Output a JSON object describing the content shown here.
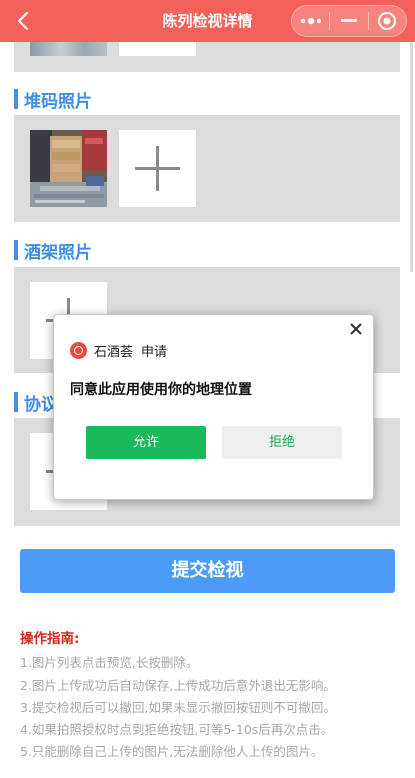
{
  "header": {
    "title": "陈列检视详情",
    "bg_color": "#f4605a",
    "back_icon": "chevron-left-icon",
    "menu_icon": "more-dots-icon",
    "minimize_icon": "minimize-icon",
    "close_icon": "target-close-icon"
  },
  "sections": [
    {
      "title": "堆码照片",
      "has_photo": true
    },
    {
      "title": "酒架照片",
      "has_photo": false
    },
    {
      "title": "协议",
      "has_photo": false
    }
  ],
  "submit": {
    "label": "提交检视",
    "color": "#4a9cf8"
  },
  "guide": {
    "title": "操作指南:",
    "lines": [
      "1.图片列表点击预览,长按删除。",
      "2.图片上传成功后自动保存,上传成功后意外退出无影响。",
      "3.提交检视后可以撤回,如果未显示撤回按钮则不可撤回。",
      "4.如果拍照授权时点到拒绝按钮,可等5-10s后再次点击。",
      "5.只能删除自己上传的图片,无法删除他人上传的图片。"
    ]
  },
  "modal": {
    "app_name": "石酒荟",
    "action": "申请",
    "message": "同意此应用使用你的地理位置",
    "allow_label": "允许",
    "deny_label": "拒绝",
    "allow_color": "#1aba5a"
  }
}
